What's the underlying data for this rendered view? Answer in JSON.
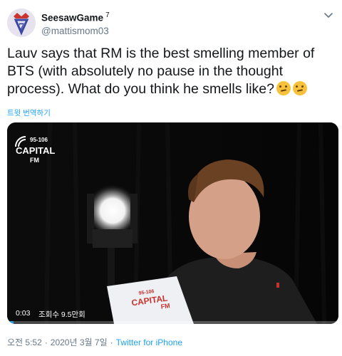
{
  "author": {
    "display_name": "SeesawGame",
    "display_name_suffix": "7",
    "handle": "@mattismom03"
  },
  "tweet": {
    "text": "Lauv says that RM is the best smelling member of BTS (with absolutely no pause in the thought process). What do you think he smells like?",
    "emojis": [
      "thinking-face",
      "thinking-face"
    ],
    "translate_label": "트윗 번역하기"
  },
  "media": {
    "logo_line1": "95-106",
    "logo_line2": "CAPITAL",
    "logo_line3": "FM",
    "card_line1": "95-106",
    "card_line2": "CAPITAL",
    "card_line3": "FM",
    "time": "0:03",
    "views": "조회수 9.5만회",
    "progress_percent": 2,
    "accent_color": "#1da1f2"
  },
  "footer": {
    "time": "오전 5:52",
    "separator": "·",
    "date": "2020년 3월 7일",
    "source": "Twitter for iPhone"
  }
}
